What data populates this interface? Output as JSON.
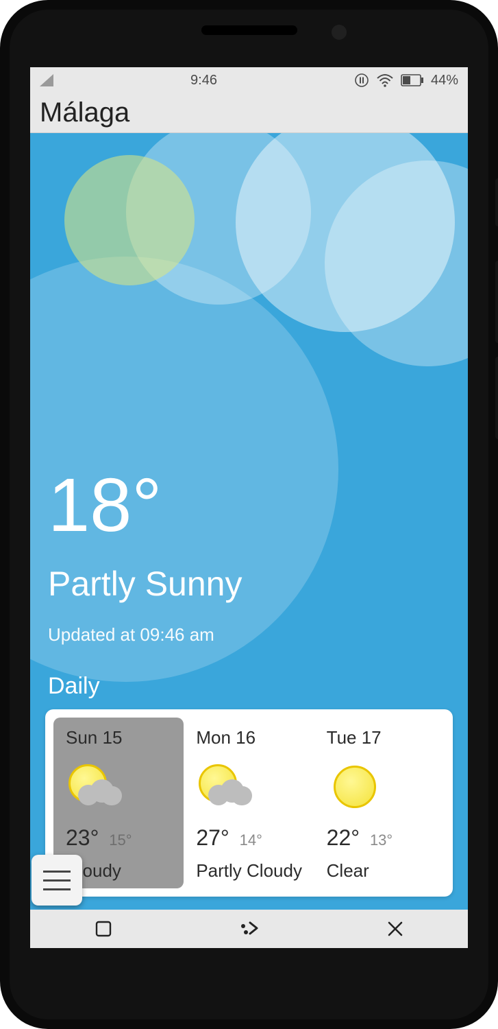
{
  "status": {
    "time": "9:46",
    "battery_pct": "44%"
  },
  "header": {
    "city": "Málaga"
  },
  "current": {
    "temp": "18°",
    "condition": "Partly Sunny",
    "updated": "Updated at 09:46 am"
  },
  "daily": {
    "label": "Daily",
    "days": [
      {
        "label": "Sun 15",
        "high": "23°",
        "low": "15°",
        "cond": "Cloudy",
        "icon": "partly",
        "selected": true
      },
      {
        "label": "Mon 16",
        "high": "27°",
        "low": "14°",
        "cond": "Partly Cloudy",
        "icon": "partly",
        "selected": false
      },
      {
        "label": "Tue 17",
        "high": "22°",
        "low": "13°",
        "cond": "Clear",
        "icon": "clear",
        "selected": false
      }
    ]
  }
}
